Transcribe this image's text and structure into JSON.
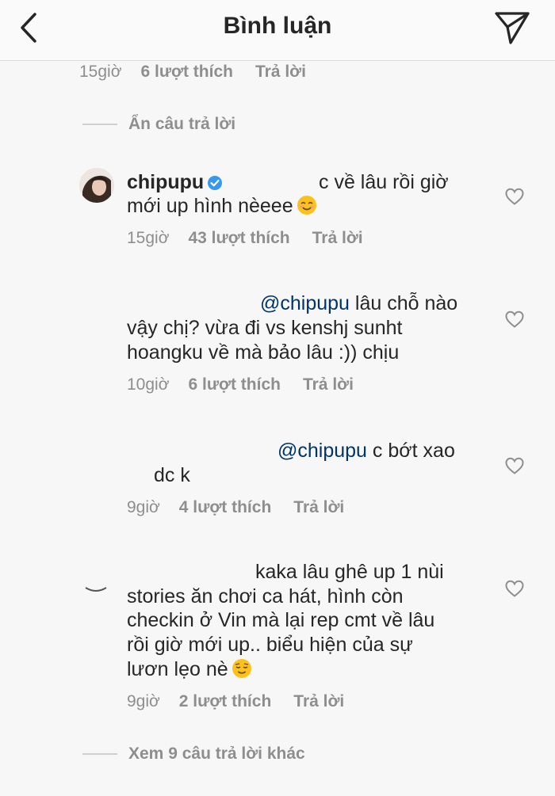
{
  "header": {
    "title": "Bình luận",
    "back_icon": "chevron-left-icon",
    "send_icon": "paper-plane-icon"
  },
  "top_meta": {
    "time": "15giờ",
    "likes": "6 lượt thích",
    "reply": "Trả lời"
  },
  "hide_replies": "Ẩn câu trả lời",
  "comments": [
    {
      "username": "chipupu",
      "verified": true,
      "line1": "c về lâu rồi giờ",
      "line2": "mới up hình nèeee",
      "emoji": "smiling-face-emoji",
      "time": "15giờ",
      "likes": "43 lượt thích",
      "reply": "Trả lời"
    },
    {
      "mention": "@chipupu",
      "line1": " lâu chỗ nào",
      "line2": "vậy chị? vừa đi vs kenshj sunht",
      "line3": "hoangku về mà bảo lâu :)) chịu",
      "time": "10giờ",
      "likes": "6 lượt thích",
      "reply": "Trả lời"
    },
    {
      "mention": "@chipupu",
      "line1": " c bớt xao",
      "line2": "dc k",
      "time": "9giờ",
      "likes": "4 lượt thích",
      "reply": "Trả lời"
    },
    {
      "line1": "kaka lâu ghê up 1 nùi",
      "line2": "stories ăn chơi ca hát, hình còn",
      "line3": "checkin ở Vin mà lại rep cmt về lâu",
      "line4": "rồi giờ mới up.. biểu hiện của sự",
      "line5": "lươn lẹo nè",
      "emoji": "relieved-face-emoji",
      "time": "9giờ",
      "likes": "2 lượt thích",
      "reply": "Trả lời"
    }
  ],
  "more_replies": "Xem 9 câu trả lời khác",
  "colors": {
    "text": "#262626",
    "secondary": "#8e8e8e",
    "mention": "#003569",
    "verified": "#3897f0"
  }
}
